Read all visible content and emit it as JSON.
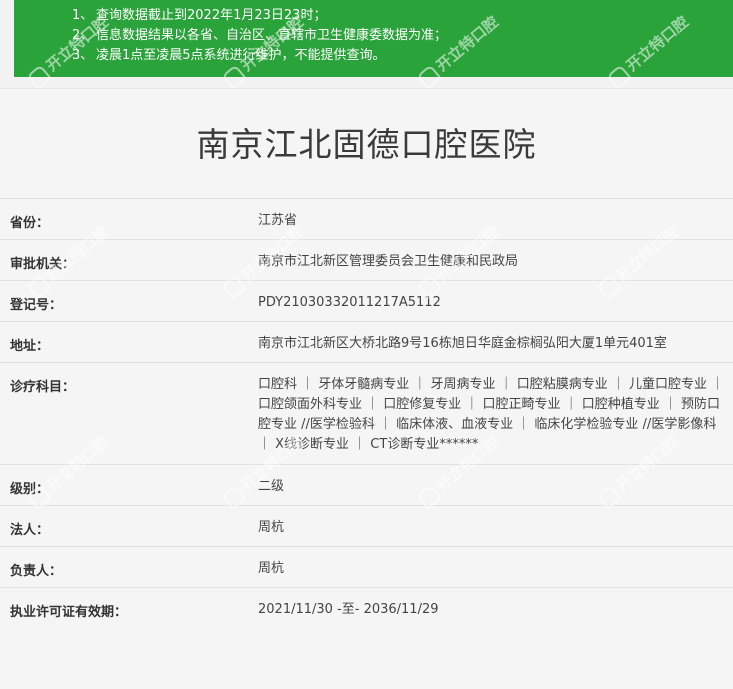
{
  "notice": {
    "lines": [
      {
        "num": "1、",
        "text": "查询数据截止到2022年1月23日23时；"
      },
      {
        "num": "2、",
        "text": "信息数据结果以各省、自治区、直辖市卫生健康委数据为准；"
      },
      {
        "num": "3、",
        "text": "凌晨1点至凌晨5点系统进行维护，不能提供查询。"
      }
    ]
  },
  "hospital": {
    "name": "南京江北固德口腔医院"
  },
  "fields": [
    {
      "label": "省份：",
      "value": "江苏省"
    },
    {
      "label": "审批机关：",
      "value": "南京市江北新区管理委员会卫生健康和民政局"
    },
    {
      "label": "登记号：",
      "value": "PDY21030332011217A5112"
    },
    {
      "label": "地址：",
      "value": "南京市江北新区大桥北路9号16栋旭日华庭金棕榈弘阳大厦1单元401室"
    },
    {
      "label": "诊疗科目：",
      "value": "口腔科 ｜ 牙体牙髓病专业 ｜ 牙周病专业 ｜ 口腔粘膜病专业 ｜ 儿童口腔专业 ｜ 口腔颌面外科专业 ｜ 口腔修复专业 ｜ 口腔正畸专业 ｜ 口腔种植专业 ｜ 预防口腔专业 //医学检验科 ｜ 临床体液、血液专业 ｜ 临床化学检验专业 //医学影像科 ｜ X线诊断专业 ｜ CT诊断专业******"
    },
    {
      "label": "级别：",
      "value": "二级"
    },
    {
      "label": "法人：",
      "value": "周杭"
    },
    {
      "label": "负责人：",
      "value": "周杭"
    },
    {
      "label": "执业许可证有效期：",
      "value": "2021/11/30 -至- 2036/11/29"
    }
  ],
  "watermark": {
    "text": "开立特口腔"
  },
  "colors": {
    "notice_bg": "#2aa33a",
    "panel_bg": "#f5f5f5"
  }
}
